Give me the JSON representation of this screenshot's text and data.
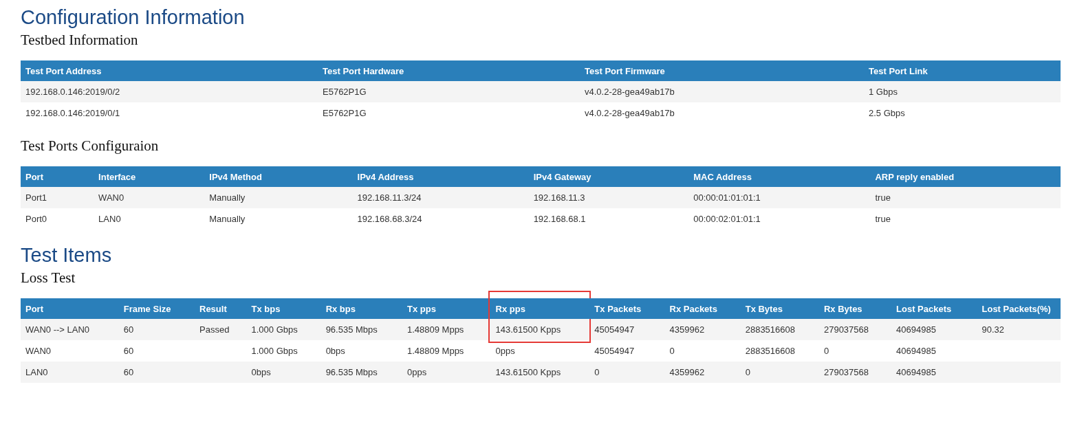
{
  "sections": [
    {
      "title": "Configuration Information",
      "subsections": [
        {
          "title": "Testbed Information",
          "table": {
            "columns": [
              {
                "label": "Test Port Address",
                "highlighted": false
              },
              {
                "label": "Test Port Hardware",
                "highlighted": false
              },
              {
                "label": "Test Port Firmware",
                "highlighted": false
              },
              {
                "label": "Test Port Link",
                "highlighted": false
              }
            ],
            "rows": [
              [
                "192.168.0.146:2019/0/2",
                "E5762P1G",
                "v4.0.2-28-gea49ab17b",
                "1 Gbps"
              ],
              [
                "192.168.0.146:2019/0/1",
                "E5762P1G",
                "v4.0.2-28-gea49ab17b",
                "2.5 Gbps"
              ]
            ]
          }
        },
        {
          "title": "Test Ports Configuraion",
          "table": {
            "columns": [
              {
                "label": "Port",
                "highlighted": false
              },
              {
                "label": "Interface",
                "highlighted": false
              },
              {
                "label": "IPv4 Method",
                "highlighted": false
              },
              {
                "label": "IPv4 Address",
                "highlighted": false
              },
              {
                "label": "IPv4 Gateway",
                "highlighted": false
              },
              {
                "label": "MAC Address",
                "highlighted": false
              },
              {
                "label": "ARP reply enabled",
                "highlighted": false
              }
            ],
            "rows": [
              [
                "Port1",
                "WAN0",
                "Manually",
                "192.168.11.3/24",
                "192.168.11.3",
                "00:00:01:01:01:1",
                "true"
              ],
              [
                "Port0",
                "LAN0",
                "Manually",
                "192.168.68.3/24",
                "192.168.68.1",
                "00:00:02:01:01:1",
                "true"
              ]
            ]
          }
        }
      ]
    },
    {
      "title": "Test Items",
      "subsections": [
        {
          "title": "Loss Test",
          "table": {
            "columns": [
              {
                "label": "Port",
                "highlighted": false
              },
              {
                "label": "Frame Size",
                "highlighted": false
              },
              {
                "label": "Result",
                "highlighted": false
              },
              {
                "label": "Tx bps",
                "highlighted": false
              },
              {
                "label": "Rx bps",
                "highlighted": false
              },
              {
                "label": "Tx pps",
                "highlighted": false
              },
              {
                "label": "Rx pps",
                "highlighted": true
              },
              {
                "label": "Tx Packets",
                "highlighted": false
              },
              {
                "label": "Rx Packets",
                "highlighted": false
              },
              {
                "label": "Tx Bytes",
                "highlighted": false
              },
              {
                "label": "Rx Bytes",
                "highlighted": false
              },
              {
                "label": "Lost Packets",
                "highlighted": false
              },
              {
                "label": "Lost Packets(%)",
                "highlighted": false
              }
            ],
            "rows": [
              [
                "WAN0 --> LAN0",
                "60",
                "Passed",
                "1.000 Gbps",
                "96.535 Mbps",
                "1.48809 Mpps",
                "143.61500 Kpps",
                "45054947",
                "4359962",
                "2883516608",
                "279037568",
                "40694985",
                "90.32"
              ],
              [
                "WAN0",
                "60",
                "",
                "1.000 Gbps",
                "0bps",
                "1.48809 Mpps",
                "0pps",
                "45054947",
                "0",
                "2883516608",
                "0",
                "40694985",
                ""
              ],
              [
                "LAN0",
                "60",
                "",
                "0bps",
                "96.535 Mbps",
                "0pps",
                "143.61500 Kpps",
                "0",
                "4359962",
                "0",
                "279037568",
                "40694985",
                ""
              ]
            ]
          }
        }
      ]
    }
  ]
}
